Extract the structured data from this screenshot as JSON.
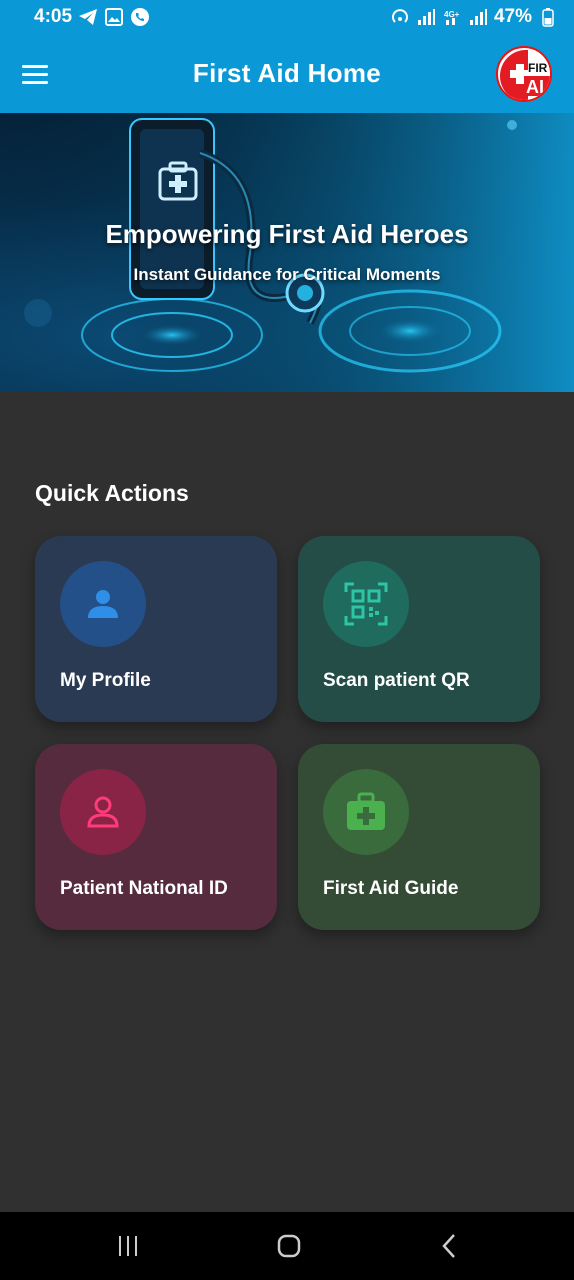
{
  "status_bar": {
    "time": "4:05",
    "battery": "47%"
  },
  "app_bar": {
    "title": "First Aid Home",
    "logo_text": "FIR AI"
  },
  "hero": {
    "title": "Empowering First Aid Heroes",
    "subtitle": "Instant Guidance for Critical Moments"
  },
  "quick_actions": {
    "title": "Quick Actions",
    "cards": [
      {
        "label": "My Profile",
        "icon": "person-icon",
        "accent": "#2f8fe8"
      },
      {
        "label": "Scan patient QR",
        "icon": "qr-scan-icon",
        "accent": "#2ec4a6"
      },
      {
        "label": "Patient National ID",
        "icon": "person-outline-icon",
        "accent": "#ff3b7a"
      },
      {
        "label": "First Aid Guide",
        "icon": "medical-bag-icon",
        "accent": "#4bb14f"
      }
    ]
  },
  "colors": {
    "primary": "#0a98d6",
    "background": "#303030"
  }
}
